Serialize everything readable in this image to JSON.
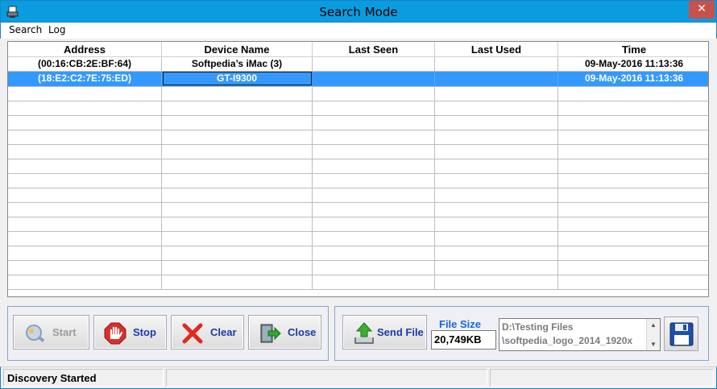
{
  "window": {
    "title": "Search Mode",
    "close_glyph": "✕",
    "icon": "bluetooth-app-icon"
  },
  "menu": {
    "items": [
      {
        "label": "Search"
      },
      {
        "label": "Log"
      }
    ]
  },
  "table": {
    "columns": [
      "Address",
      "Device Name",
      "Last Seen",
      "Last Used",
      "Time"
    ],
    "rows": [
      {
        "address": "(00:16:CB:2E:BF:64)",
        "device_name": "Softpedia’s iMac (3)",
        "last_seen": "",
        "last_used": "",
        "time": "09-May-2016 11:13:36",
        "selected": false
      },
      {
        "address": "(18:E2:C2:7E:75:ED)",
        "device_name": "GT-I9300",
        "last_seen": "",
        "last_used": "",
        "time": "09-May-2016 11:13:36",
        "selected": true
      }
    ],
    "selection_color": "#3399ff"
  },
  "toolbar": {
    "start_label": "Start",
    "stop_label": "Stop",
    "clear_label": "Clear",
    "close_label": "Close",
    "send_file_label": "Send File",
    "start_enabled": false
  },
  "file": {
    "size_label": "File Size",
    "size_value": "20,749KB",
    "path_line1": "D:\\Testing Files",
    "path_line2": "\\softpedia_logo_2014_1920x"
  },
  "status": {
    "text": "Discovery Started"
  },
  "colors": {
    "titlebar": "#0b9ce0",
    "button_text": "#1c3aa8",
    "file_size_label": "#1c64d8",
    "close_button": "#c7514c"
  }
}
